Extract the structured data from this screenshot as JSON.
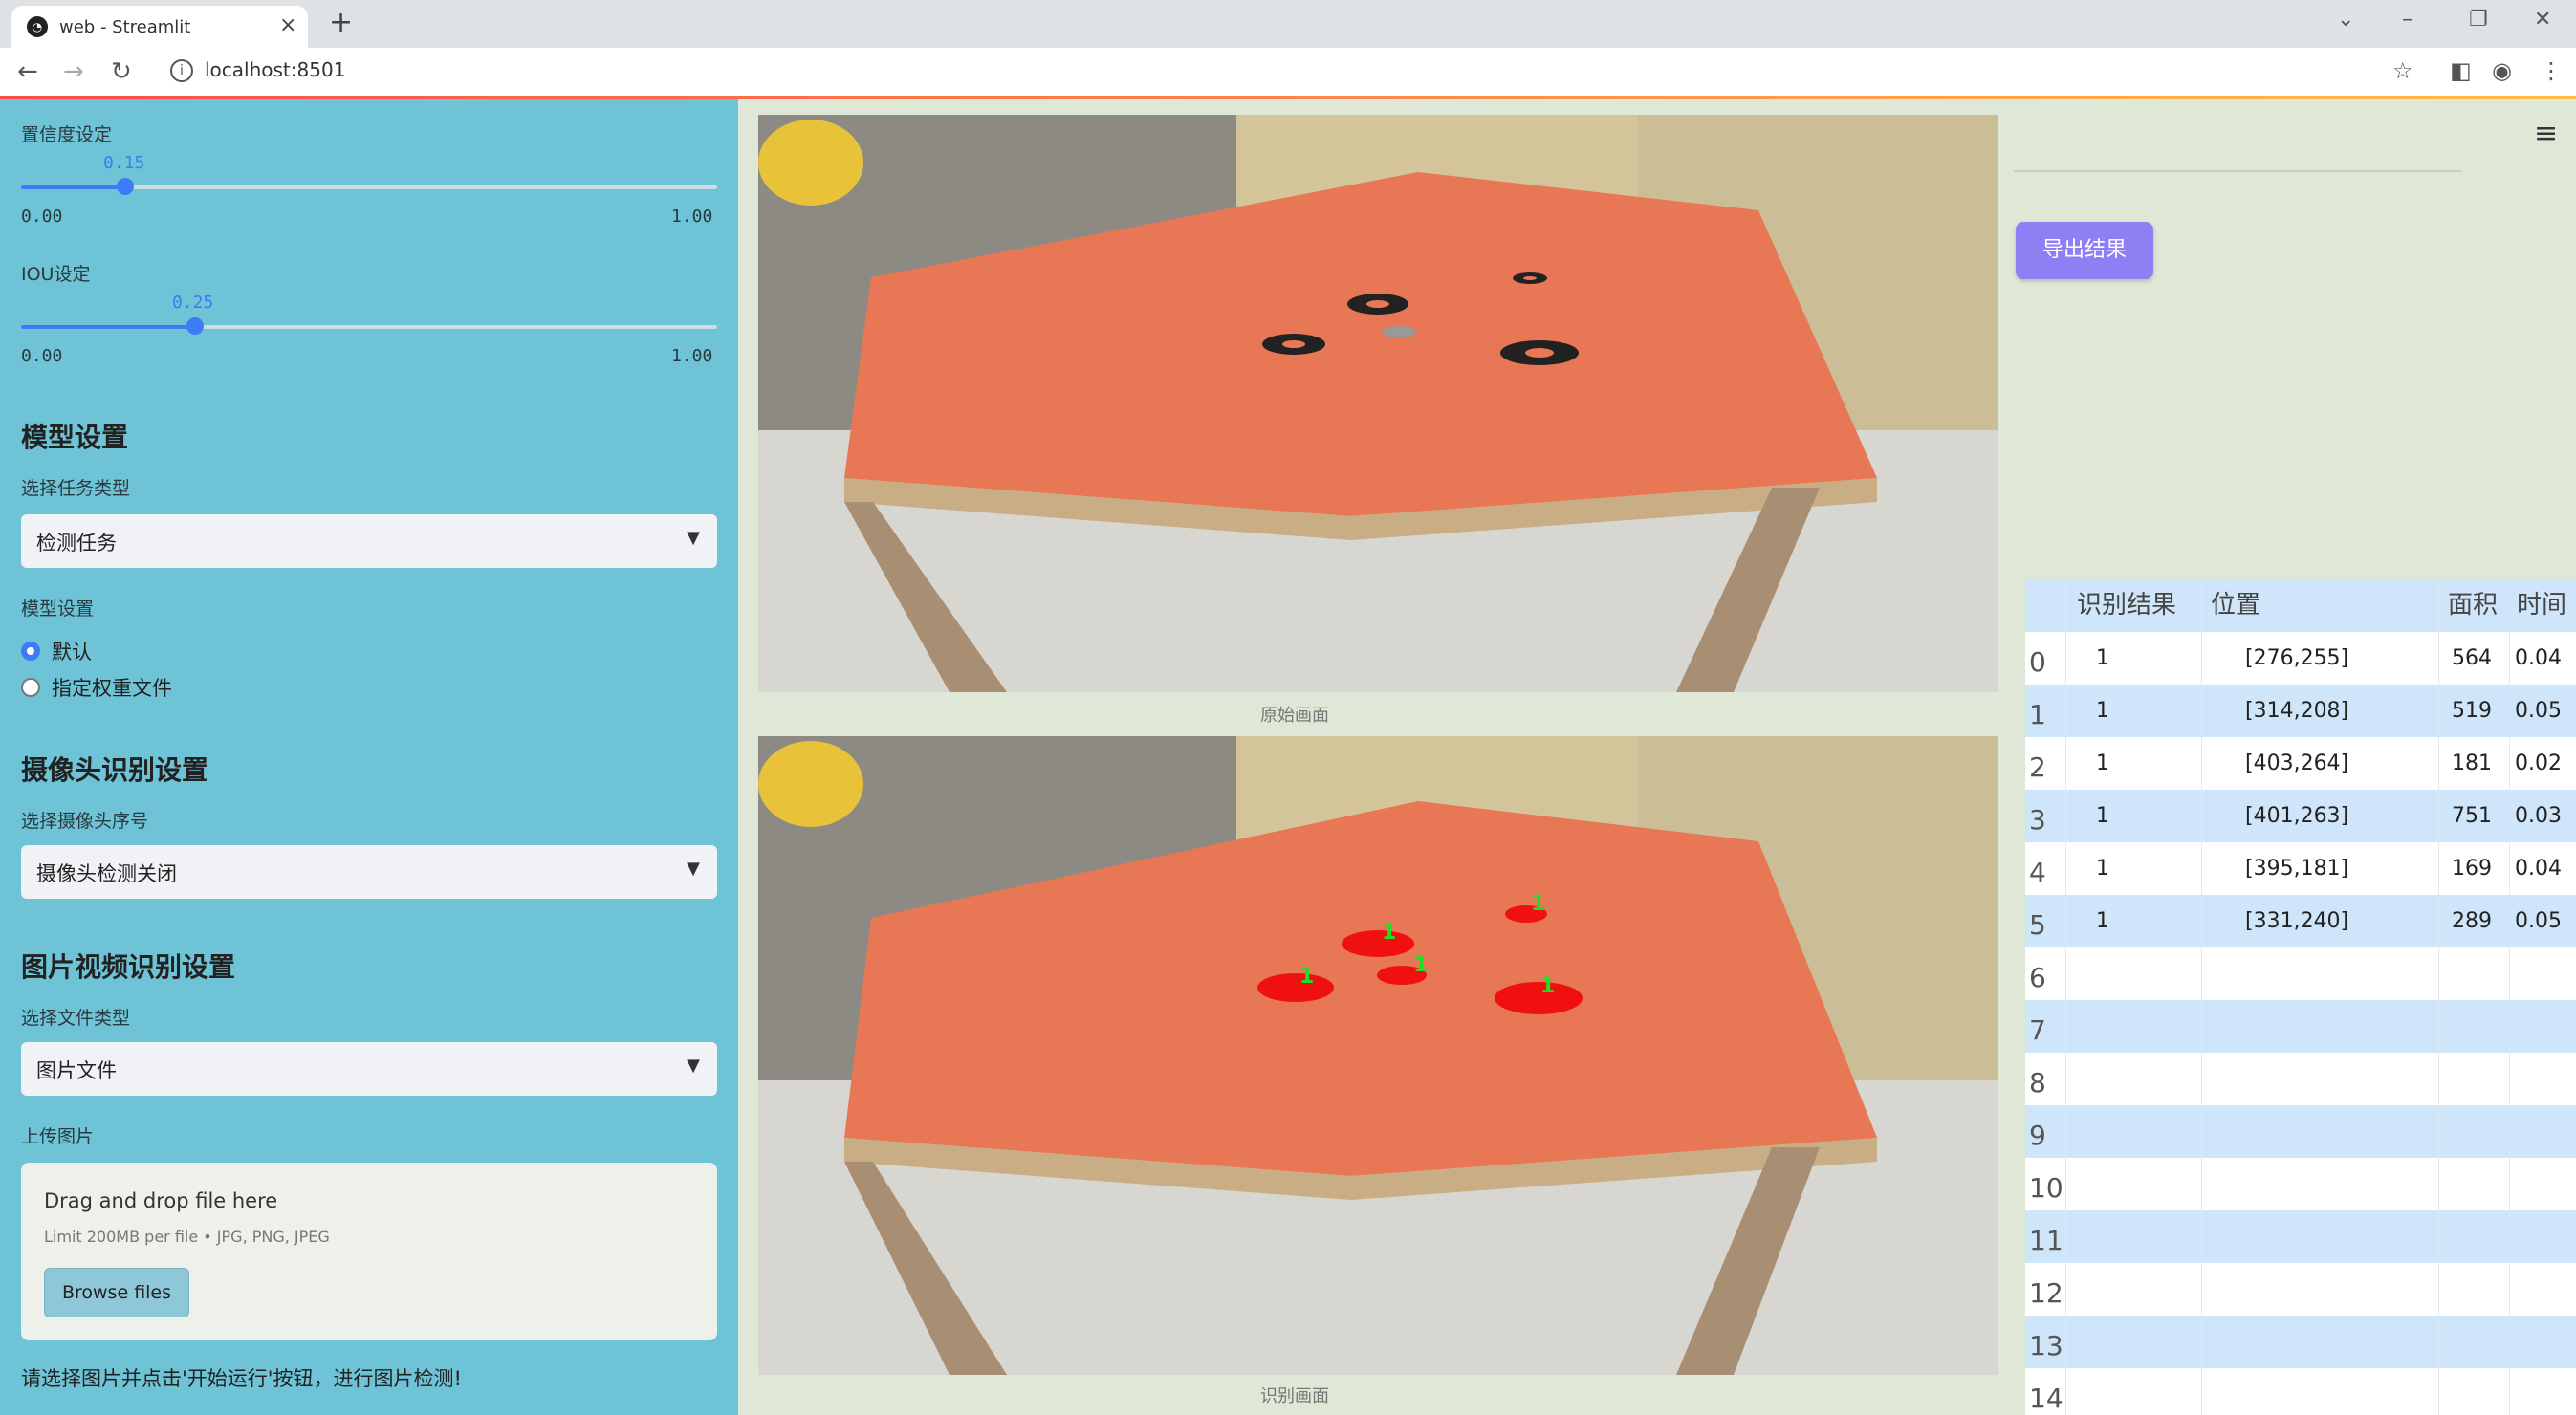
{
  "browser": {
    "tab_title": "web - Streamlit",
    "url": "localhost:8501"
  },
  "sidebar": {
    "conf": {
      "label": "置信度设定",
      "value": "0.15",
      "fraction": 0.15,
      "min": "0.00",
      "max": "1.00"
    },
    "iou": {
      "label": "IOU设定",
      "value": "0.25",
      "fraction": 0.25,
      "min": "0.00",
      "max": "1.00"
    },
    "model_section": "模型设置",
    "task_label": "选择任务类型",
    "task_value": "检测任务",
    "model_label": "模型设置",
    "model_options": [
      "默认",
      "指定权重文件"
    ],
    "camera_section": "摄像头识别设置",
    "camera_label": "选择摄像头序号",
    "camera_value": "摄像头检测关闭",
    "file_section": "图片视频识别设置",
    "file_type_label": "选择文件类型",
    "file_type_value": "图片文件",
    "upload_label": "上传图片",
    "upload_title": "Drag and drop file here",
    "upload_limit": "Limit 200MB per file • JPG, PNG, JPEG",
    "browse_label": "Browse files",
    "hint": "请选择图片并点击'开始运行'按钮，进行图片检测!"
  },
  "main": {
    "original_caption": "原始画面",
    "result_caption": "识别画面",
    "export_label": "导出结果",
    "detection_label": "1"
  },
  "table": {
    "headers": [
      "识别结果",
      "位置",
      "面积",
      "时间"
    ],
    "rows": [
      [
        "0",
        "1",
        "[276,255]",
        "564",
        "0.04"
      ],
      [
        "1",
        "1",
        "[314,208]",
        "519",
        "0.05"
      ],
      [
        "2",
        "1",
        "[403,264]",
        "181",
        "0.02"
      ],
      [
        "3",
        "1",
        "[401,263]",
        "751",
        "0.03"
      ],
      [
        "4",
        "1",
        "[395,181]",
        "169",
        "0.04"
      ],
      [
        "5",
        "1",
        "[331,240]",
        "289",
        "0.05"
      ],
      [
        "6",
        "",
        "",
        "",
        ""
      ],
      [
        "7",
        "",
        "",
        "",
        ""
      ],
      [
        "8",
        "",
        "",
        "",
        ""
      ],
      [
        "9",
        "",
        "",
        "",
        ""
      ],
      [
        "10",
        "",
        "",
        "",
        ""
      ],
      [
        "11",
        "",
        "",
        "",
        ""
      ],
      [
        "12",
        "",
        "",
        "",
        ""
      ],
      [
        "13",
        "",
        "",
        "",
        ""
      ],
      [
        "14",
        "",
        "",
        "",
        ""
      ]
    ]
  }
}
